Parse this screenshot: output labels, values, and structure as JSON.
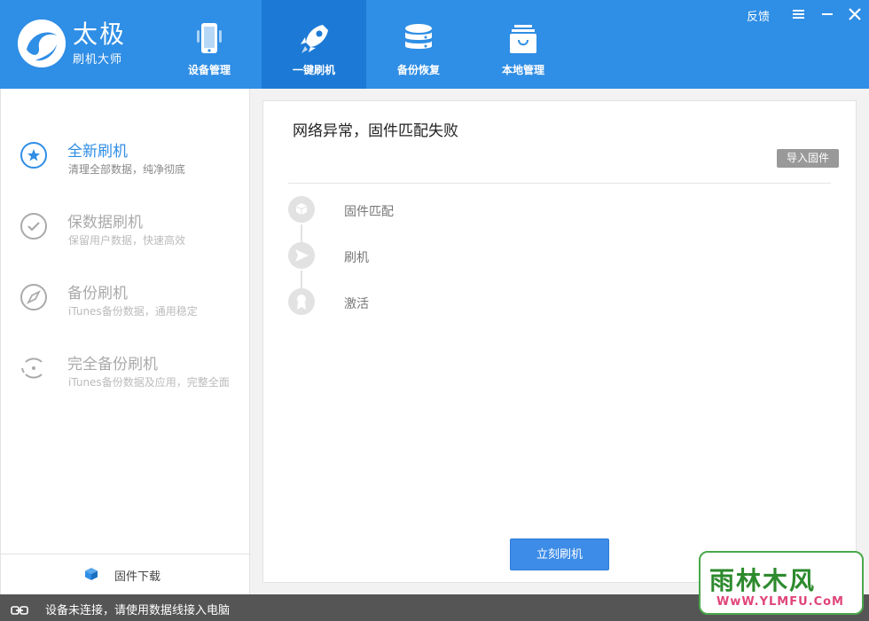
{
  "app": {
    "logo_title": "太极",
    "logo_subtitle": "刷机大师",
    "brand_color": "#2f8ee5",
    "active_tab_color": "#1c7ad6"
  },
  "nav": {
    "tabs": [
      {
        "label": "设备管理",
        "icon": "phone-icon",
        "active": false
      },
      {
        "label": "一键刷机",
        "icon": "rocket-icon",
        "active": true
      },
      {
        "label": "备份恢复",
        "icon": "database-icon",
        "active": false
      },
      {
        "label": "本地管理",
        "icon": "bag-icon",
        "active": false
      }
    ]
  },
  "window_controls": {
    "feedback_label": "反馈",
    "menu_icon": "menu-icon",
    "minimize_icon": "minimize-icon",
    "close_icon": "close-icon"
  },
  "sidebar": {
    "modes": [
      {
        "title": "全新刷机",
        "subtitle": "清理全部数据，纯净彻底",
        "icon": "star-circle-icon",
        "active": true
      },
      {
        "title": "保数据刷机",
        "subtitle": "保留用户数据，快速高效",
        "icon": "check-circle-icon",
        "active": false
      },
      {
        "title": "备份刷机",
        "subtitle": "iTunes备份数据，通用稳定",
        "icon": "compass-icon",
        "active": false
      },
      {
        "title": "完全备份刷机",
        "subtitle": "iTunes备份数据及应用，完整全面",
        "icon": "sync-circle-icon",
        "active": false
      }
    ],
    "footer_label": "固件下载",
    "footer_icon": "cube-icon"
  },
  "main": {
    "status_title": "网络异常，固件匹配失败",
    "import_button": "导入固件",
    "steps": [
      {
        "label": "固件匹配",
        "icon": "box-icon"
      },
      {
        "label": "刷机",
        "icon": "send-icon"
      },
      {
        "label": "激活",
        "icon": "badge-icon"
      }
    ],
    "flash_button": "立刻刷机"
  },
  "statusbar": {
    "text": "设备未连接，请使用数据线接入电脑",
    "icon": "link-icon"
  },
  "watermark": {
    "main": "雨林木风",
    "sub": "WwW.YLMFU.CoM"
  }
}
